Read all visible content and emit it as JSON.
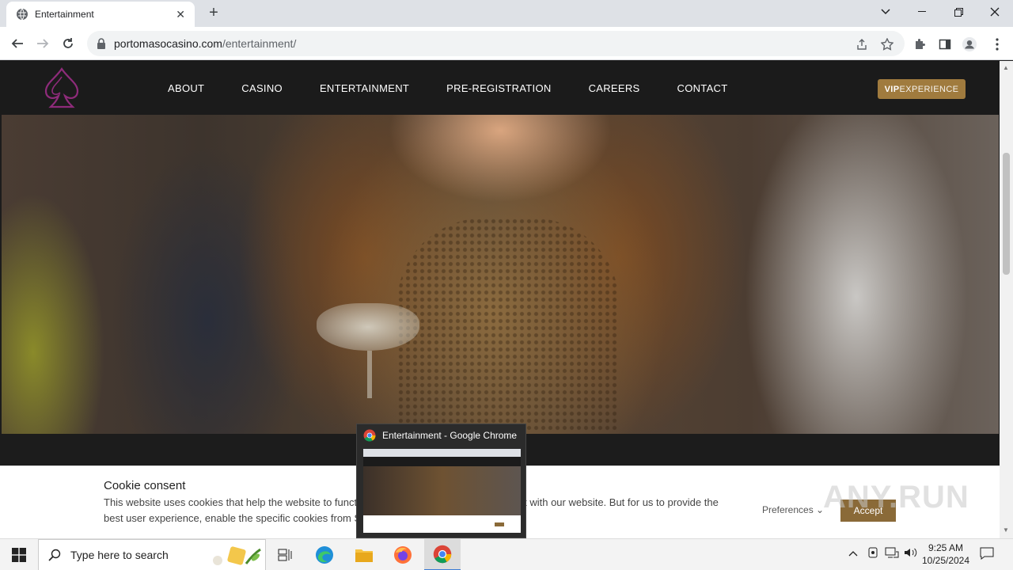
{
  "browser": {
    "tab_title": "Entertainment",
    "url_host": "portomasocasino.com",
    "url_path": "/entertainment/"
  },
  "site": {
    "nav": [
      "ABOUT",
      "CASINO",
      "ENTERTAINMENT",
      "PRE-REGISTRATION",
      "CAREERS",
      "CONTACT"
    ],
    "vip_bold": "VIP",
    "vip_rest": "EXPERIENCE"
  },
  "cookie": {
    "title": "Cookie consent",
    "text": "This website uses cookies that help the website to function and also to track how you interact with our website. But for us to provide the best user experience, enable the specific cookies from Settings, and click on Accept.",
    "preferences": "Preferences",
    "accept": "Accept"
  },
  "preview": {
    "title": "Entertainment - Google Chrome"
  },
  "watermark": "ANY.RUN",
  "taskbar": {
    "search_placeholder": "Type here to search",
    "time": "9:25 AM",
    "date": "10/25/2024"
  },
  "colors": {
    "accent_gold": "#a07b3e",
    "logo_purple": "#8e2b7a",
    "nav_bg": "#1b1b1b"
  }
}
